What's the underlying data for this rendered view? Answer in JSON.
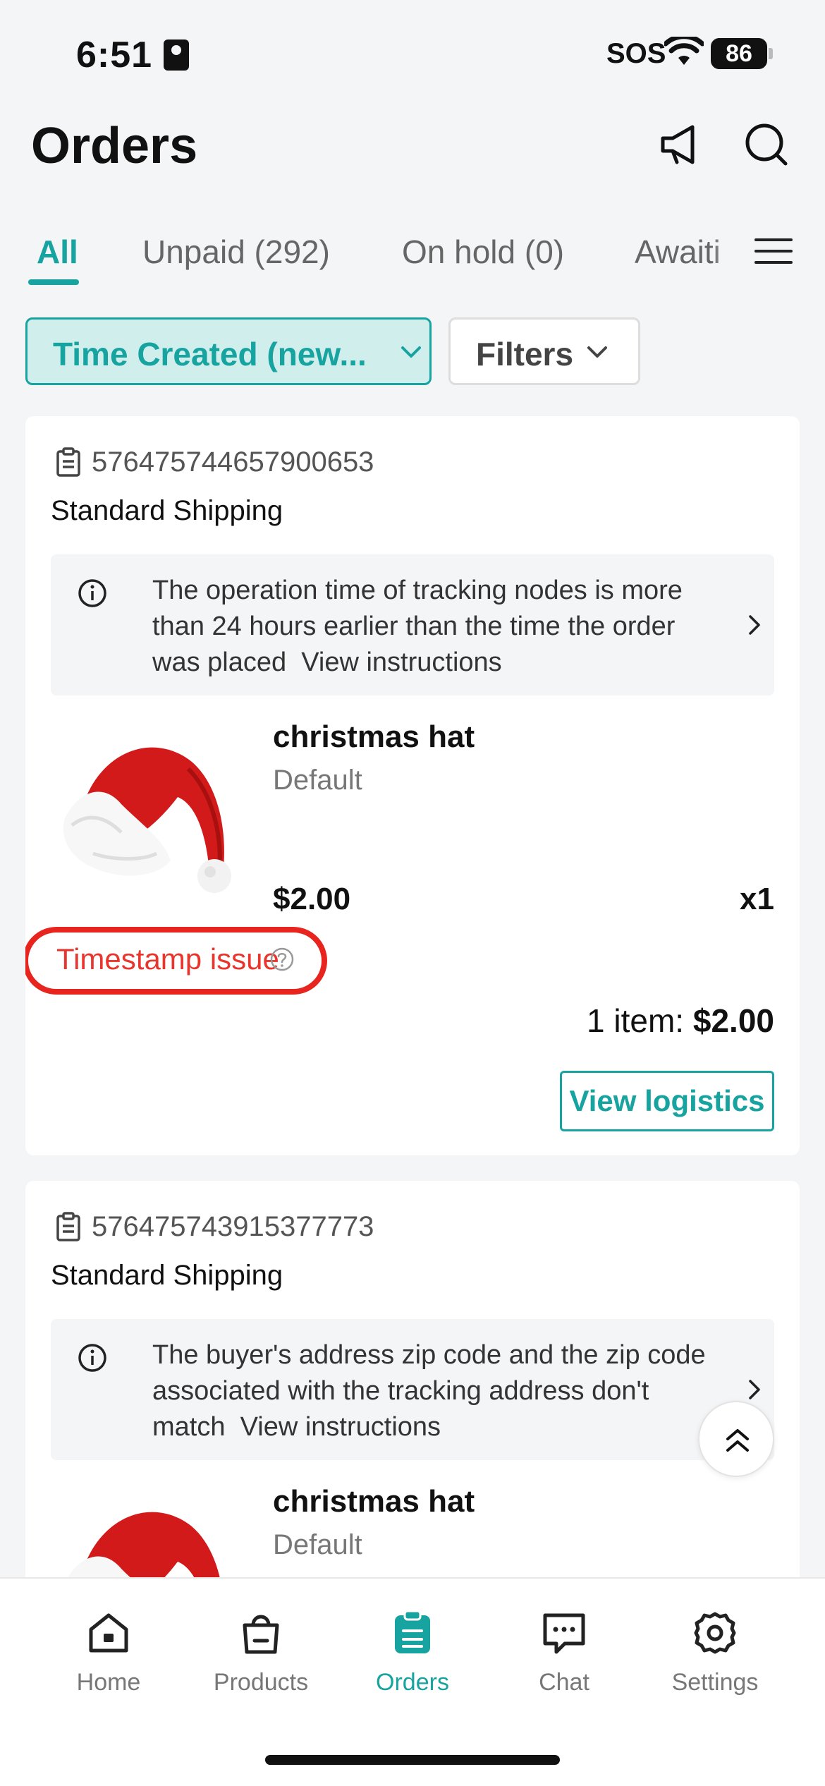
{
  "status_bar": {
    "time": "6:51",
    "sos": "SOS",
    "battery": "86"
  },
  "header": {
    "title": "Orders"
  },
  "tabs": [
    {
      "label": "All"
    },
    {
      "label": "Unpaid (292)"
    },
    {
      "label": "On hold (0)"
    },
    {
      "label": "Awaiti"
    }
  ],
  "filters": {
    "sort_label": "Time Created (new...",
    "filters_label": "Filters"
  },
  "orders": [
    {
      "id": "576475744657900653",
      "shipping": "Standard Shipping",
      "notice": "The operation time of tracking nodes is more than 24 hours earlier than the time the order was placed",
      "notice_link": "View instructions",
      "product_name": "christmas hat",
      "variant": "Default",
      "price": "$2.00",
      "qty": "x1",
      "issue": "Timestamp issue",
      "total_prefix": "1 item: ",
      "total_amount": "$2.00",
      "action": "View logistics"
    },
    {
      "id": "576475743915377773",
      "shipping": "Standard Shipping",
      "notice": "The buyer's address zip code and the zip code associated with the tracking address don't match",
      "notice_link": "View instructions",
      "product_name": "christmas hat",
      "variant": "Default"
    }
  ],
  "bottom_nav": [
    {
      "label": "Home",
      "icon": "home-icon"
    },
    {
      "label": "Products",
      "icon": "bag-icon"
    },
    {
      "label": "Orders",
      "icon": "orders-icon"
    },
    {
      "label": "Chat",
      "icon": "chat-icon"
    },
    {
      "label": "Settings",
      "icon": "gear-icon"
    }
  ],
  "colors": {
    "accent": "#17a3a0",
    "issue_red": "#e8362e",
    "highlight_ring": "#e8241f"
  }
}
